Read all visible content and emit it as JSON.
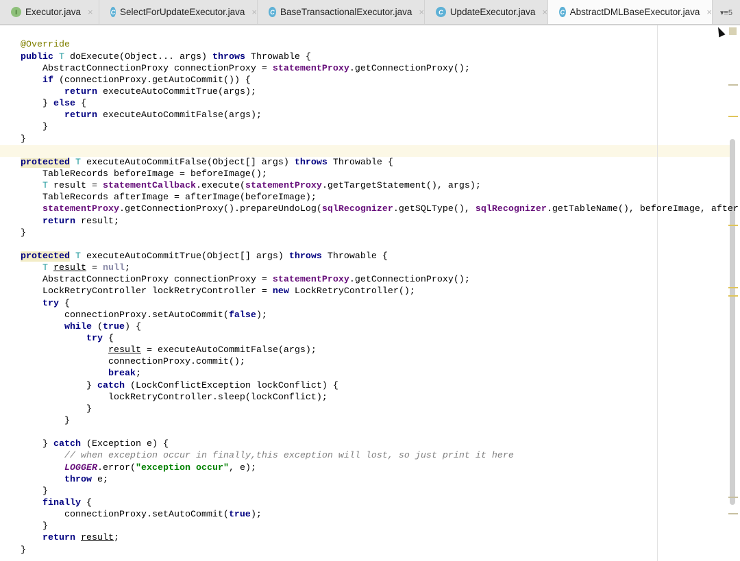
{
  "tabs": [
    {
      "label": "Executor.java",
      "icon": "I",
      "kind": "interface"
    },
    {
      "label": "SelectForUpdateExecutor.java",
      "icon": "C",
      "kind": "class"
    },
    {
      "label": "BaseTransactionalExecutor.java",
      "icon": "C",
      "kind": "class"
    },
    {
      "label": "UpdateExecutor.java",
      "icon": "C",
      "kind": "class"
    },
    {
      "label": "AbstractDMLBaseExecutor.java",
      "icon": "C",
      "kind": "class",
      "active": true
    }
  ],
  "close_glyph": "×",
  "overflow_label": "▾≡5",
  "code": {
    "lines": [
      [
        [
          "p",
          "}"
        ]
      ],
      [],
      [
        [
          "a",
          "@Override"
        ]
      ],
      [
        [
          "k",
          "public"
        ],
        [
          "p",
          " "
        ],
        [
          "t",
          "T"
        ],
        [
          "p",
          " doExecute(Object... args) "
        ],
        [
          "k",
          "throws"
        ],
        [
          "p",
          " Throwable {"
        ]
      ],
      [
        [
          "p",
          "    AbstractConnectionProxy connectionProxy = "
        ],
        [
          "f",
          "statementProxy"
        ],
        [
          "p",
          ".getConnectionProxy();"
        ]
      ],
      [
        [
          "p",
          "    "
        ],
        [
          "k",
          "if"
        ],
        [
          "p",
          " (connectionProxy.getAutoCommit()) {"
        ]
      ],
      [
        [
          "p",
          "        "
        ],
        [
          "k",
          "return"
        ],
        [
          "p",
          " executeAutoCommitTrue(args);"
        ]
      ],
      [
        [
          "p",
          "    } "
        ],
        [
          "k",
          "else"
        ],
        [
          "p",
          " {"
        ]
      ],
      [
        [
          "p",
          "        "
        ],
        [
          "k",
          "return"
        ],
        [
          "p",
          " executeAutoCommitFalse(args);"
        ]
      ],
      [
        [
          "p",
          "    }"
        ]
      ],
      [
        [
          "p",
          "}"
        ]
      ],
      [],
      [
        [
          "kh",
          "protected"
        ],
        [
          "p",
          " "
        ],
        [
          "t",
          "T"
        ],
        [
          "p",
          " executeAutoCommitFalse(Object[] args) "
        ],
        [
          "k",
          "throws"
        ],
        [
          "p",
          " Throwable {"
        ]
      ],
      [
        [
          "p",
          "    TableRecords beforeImage = beforeImage();"
        ]
      ],
      [
        [
          "p",
          "    "
        ],
        [
          "t",
          "T"
        ],
        [
          "p",
          " result = "
        ],
        [
          "f",
          "statementCallback"
        ],
        [
          "p",
          ".execute("
        ],
        [
          "f",
          "statementProxy"
        ],
        [
          "p",
          ".getTargetStatement(), args);"
        ]
      ],
      [
        [
          "p",
          "    TableRecords afterImage = afterImage(beforeImage);"
        ]
      ],
      [
        [
          "p",
          "    "
        ],
        [
          "f",
          "statementProxy"
        ],
        [
          "p",
          ".getConnectionProxy().prepareUndoLog("
        ],
        [
          "f",
          "sqlRecognizer"
        ],
        [
          "p",
          ".getSQLType(), "
        ],
        [
          "f",
          "sqlRecognizer"
        ],
        [
          "p",
          ".getTableName(), beforeImage, after"
        ]
      ],
      [
        [
          "p",
          "    "
        ],
        [
          "k",
          "return"
        ],
        [
          "p",
          " result;"
        ]
      ],
      [
        [
          "p",
          "}"
        ]
      ],
      [],
      [
        [
          "kh",
          "protected"
        ],
        [
          "p",
          " "
        ],
        [
          "t",
          "T"
        ],
        [
          "p",
          " executeAutoCommitTrue(Object[] args) "
        ],
        [
          "k",
          "throws"
        ],
        [
          "p",
          " Throwable {"
        ]
      ],
      [
        [
          "p",
          "    "
        ],
        [
          "t",
          "T"
        ],
        [
          "p",
          " "
        ],
        [
          "u",
          "result"
        ],
        [
          "p",
          " = "
        ],
        [
          "n",
          "null"
        ],
        [
          "p",
          ";"
        ]
      ],
      [
        [
          "p",
          "    AbstractConnectionProxy connectionProxy = "
        ],
        [
          "f",
          "statementProxy"
        ],
        [
          "p",
          ".getConnectionProxy();"
        ]
      ],
      [
        [
          "p",
          "    LockRetryController lockRetryController = "
        ],
        [
          "k",
          "new"
        ],
        [
          "p",
          " LockRetryController();"
        ]
      ],
      [
        [
          "p",
          "    "
        ],
        [
          "k",
          "try"
        ],
        [
          "p",
          " {"
        ]
      ],
      [
        [
          "p",
          "        connectionProxy.setAutoCommit("
        ],
        [
          "k",
          "false"
        ],
        [
          "p",
          ");"
        ]
      ],
      [
        [
          "p",
          "        "
        ],
        [
          "k",
          "while"
        ],
        [
          "p",
          " ("
        ],
        [
          "k",
          "true"
        ],
        [
          "p",
          ") {"
        ]
      ],
      [
        [
          "p",
          "            "
        ],
        [
          "k",
          "try"
        ],
        [
          "p",
          " {"
        ]
      ],
      [
        [
          "p",
          "                "
        ],
        [
          "u",
          "result"
        ],
        [
          "p",
          " = executeAutoCommitFalse(args);"
        ]
      ],
      [
        [
          "p",
          "                connectionProxy.commit();"
        ]
      ],
      [
        [
          "p",
          "                "
        ],
        [
          "k",
          "break"
        ],
        [
          "p",
          ";"
        ]
      ],
      [
        [
          "p",
          "            } "
        ],
        [
          "k",
          "catch"
        ],
        [
          "p",
          " (LockConflictException lockConflict) {"
        ]
      ],
      [
        [
          "p",
          "                lockRetryController.sleep(lockConflict);"
        ]
      ],
      [
        [
          "p",
          "            }"
        ]
      ],
      [
        [
          "p",
          "        }"
        ]
      ],
      [],
      [
        [
          "p",
          "    } "
        ],
        [
          "k",
          "catch"
        ],
        [
          "p",
          " (Exception e) {"
        ]
      ],
      [
        [
          "p",
          "        "
        ],
        [
          "c",
          "// when exception occur in finally,this exception will lost, so just print it here"
        ]
      ],
      [
        [
          "p",
          "        "
        ],
        [
          "L",
          "LOGGER"
        ],
        [
          "p",
          ".error("
        ],
        [
          "s",
          "\"exception occur\""
        ],
        [
          "p",
          ", e);"
        ]
      ],
      [
        [
          "p",
          "        "
        ],
        [
          "k",
          "throw"
        ],
        [
          "p",
          " e;"
        ]
      ],
      [
        [
          "p",
          "    }"
        ]
      ],
      [
        [
          "p",
          "    "
        ],
        [
          "k",
          "finally"
        ],
        [
          "p",
          " {"
        ]
      ],
      [
        [
          "p",
          "        connectionProxy.setAutoCommit("
        ],
        [
          "k",
          "true"
        ],
        [
          "p",
          ");"
        ]
      ],
      [
        [
          "p",
          "    }"
        ]
      ],
      [
        [
          "p",
          "    "
        ],
        [
          "k",
          "return"
        ],
        [
          "p",
          " "
        ],
        [
          "u",
          "result"
        ],
        [
          "p",
          ";"
        ]
      ],
      [
        [
          "p",
          "}"
        ]
      ]
    ],
    "caret_line": 11
  },
  "colors": {
    "keyword": "#000080",
    "field": "#660e7a",
    "string": "#008000",
    "comment": "#808080",
    "annotation": "#808000",
    "type_param": "#20999d"
  }
}
